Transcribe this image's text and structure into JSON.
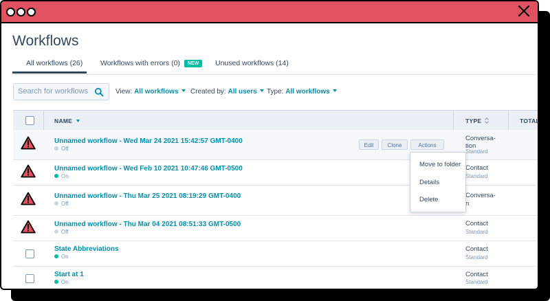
{
  "page": {
    "title": "Workflows"
  },
  "tabs": [
    {
      "label": "All workflows (26)",
      "active": true
    },
    {
      "label": "Workflows with errors (0)",
      "badge": "NEW"
    },
    {
      "label": "Unused workflows (14)"
    }
  ],
  "search": {
    "placeholder": "Search for workflows"
  },
  "filters": {
    "view": {
      "label": "View:",
      "value": "All workflows"
    },
    "created": {
      "label": "Created by:",
      "value": "All users"
    },
    "type": {
      "label": "Type:",
      "value": "All workflows"
    }
  },
  "columns": {
    "name": "NAME",
    "type": "TYPE",
    "total": "TOTAL E"
  },
  "rows": [
    {
      "name": "Unnamed workflow - Wed Mar 24 2021 15:42:57 GMT-0400",
      "status": "Off",
      "type": "Conversa-\ntion",
      "type_sub": "Standard",
      "warning": true
    },
    {
      "name": "Unnamed workflow - Wed Feb 10 2021 10:47:46 GMT-0500",
      "status": "On",
      "type": "Contact",
      "type_sub": "Standard",
      "warning": true
    },
    {
      "name": "Unnamed workflow - Thu Mar 25 2021 08:19:29 GMT-0400",
      "status": "Off",
      "type": "Conversa-",
      "type_sub": "n",
      "warning": true
    },
    {
      "name": "Unnamed workflow - Thu Mar 04 2021 08:51:33 GMT-0500",
      "status": "Off",
      "type": "Contact",
      "type_sub": "Standard",
      "warning": true
    },
    {
      "name": "State Abbreviations",
      "status": "On",
      "type": "Contact",
      "type_sub": "Standard",
      "warning": false
    },
    {
      "name": "Start at 1",
      "status": "On",
      "type": "Contact",
      "type_sub": "Standard",
      "warning": false
    }
  ],
  "row_actions": {
    "edit": "Edit",
    "clone": "Clone",
    "actions": "Actions"
  },
  "actions_menu": [
    "Move to folder",
    "Details",
    "Delete"
  ],
  "colors": {
    "titlebar": "#e0525f",
    "link": "#0091ae",
    "on": "#00bda5",
    "off": "#cbd6e2",
    "warning": "#e0525f"
  }
}
